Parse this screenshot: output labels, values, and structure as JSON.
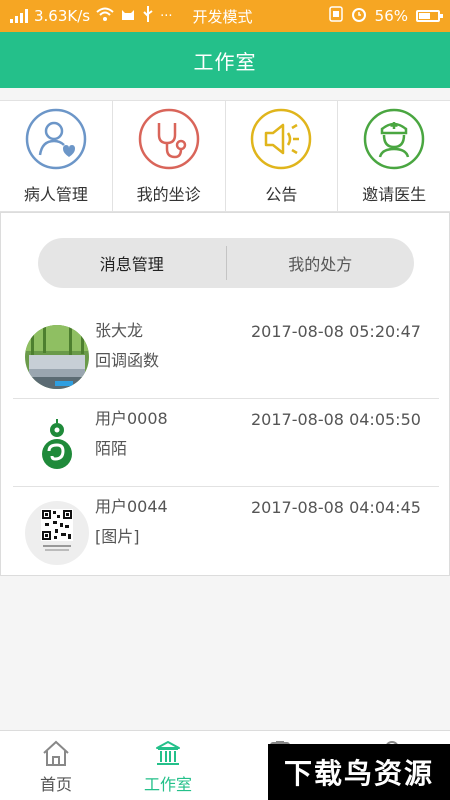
{
  "status_bar": {
    "speed": "3.63K/s",
    "mode": "开发模式",
    "battery": "56%",
    "battery_level": 0.56
  },
  "title": "工作室",
  "grid": [
    {
      "label": "病人管理",
      "icon": "patient-heart-icon",
      "color": "#6c96c8"
    },
    {
      "label": "我的坐诊",
      "icon": "stethoscope-icon",
      "color": "#d9655a"
    },
    {
      "label": "公告",
      "icon": "megaphone-icon",
      "color": "#e0b51c"
    },
    {
      "label": "邀请医生",
      "icon": "doctor-icon",
      "color": "#4aa641"
    }
  ],
  "tabs": [
    {
      "label": "消息管理",
      "active": true
    },
    {
      "label": "我的处方",
      "active": false
    }
  ],
  "messages": [
    {
      "name": "张大龙",
      "text": "回调函数",
      "time": "2017-08-08 05:20:47",
      "avatar": "sofa-photo"
    },
    {
      "name": "用户0008",
      "text": "陌陌",
      "time": "2017-08-08 04:05:50",
      "avatar": "green-gourd-logo"
    },
    {
      "name": "用户0044",
      "text": "[图片]",
      "time": "2017-08-08 04:04:45",
      "avatar": "qr-code"
    }
  ],
  "bottom_nav": [
    {
      "label": "首页",
      "icon": "home-icon",
      "active": false
    },
    {
      "label": "工作室",
      "icon": "building-icon",
      "active": true
    },
    {
      "label": "",
      "icon": "clipboard-icon",
      "active": false
    },
    {
      "label": "",
      "icon": "person-icon",
      "active": false
    }
  ],
  "watermark": "下载鸟资源",
  "colors": {
    "accent": "#24c08a",
    "status_bar": "#f6a623"
  }
}
